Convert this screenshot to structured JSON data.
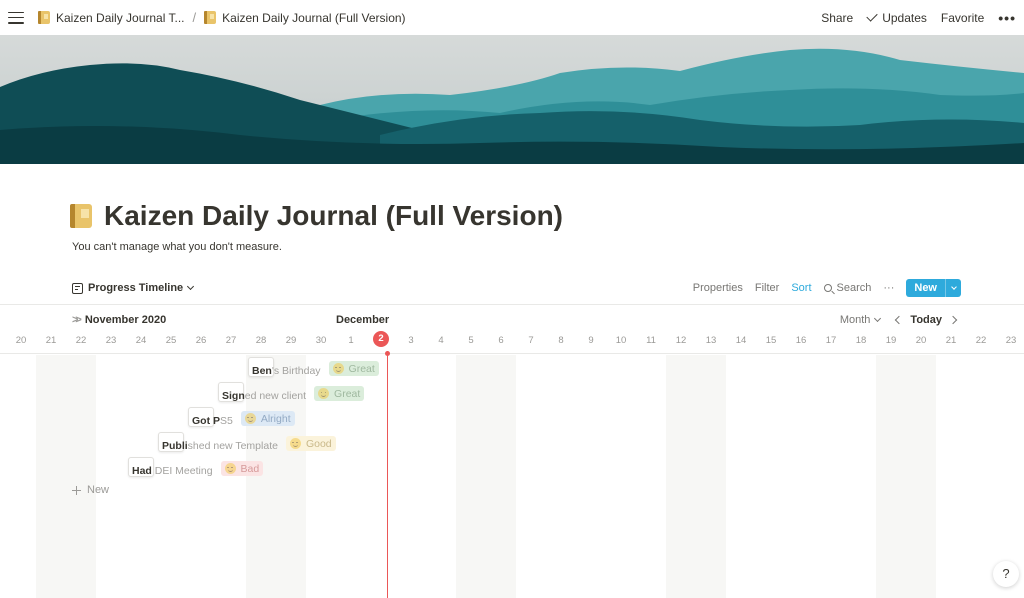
{
  "topbar": {
    "breadcrumb": [
      {
        "label": "Kaizen Daily Journal T..."
      },
      {
        "label": "Kaizen Daily Journal (Full Version)"
      }
    ],
    "separator": "/",
    "share": "Share",
    "updates": "Updates",
    "favorite": "Favorite",
    "more": "•••"
  },
  "page": {
    "title": "Kaizen Daily Journal (Full Version)",
    "subtitle": "You can't manage what you don't measure."
  },
  "view": {
    "name": "Progress Timeline",
    "actions": {
      "properties": "Properties",
      "filter": "Filter",
      "sort": "Sort",
      "search": "Search",
      "more": "···",
      "new": "New"
    }
  },
  "timeline": {
    "month_left": "November 2020",
    "month_right": "December",
    "scale": "Month",
    "today": "Today",
    "today_day": "2",
    "days": [
      "20",
      "21",
      "22",
      "23",
      "24",
      "25",
      "26",
      "27",
      "28",
      "29",
      "30",
      "1",
      "2",
      "3",
      "4",
      "5",
      "6",
      "7",
      "8",
      "9",
      "10",
      "11",
      "12",
      "13",
      "14",
      "15",
      "16",
      "17",
      "18",
      "19",
      "20",
      "21",
      "22",
      "23"
    ],
    "items": [
      {
        "lead": "Ben",
        "rest": "'s Birthday",
        "mood": "Great",
        "mood_color": "#dbeddb",
        "text_color": "#9fb89f",
        "emoji_color": "#f2c94c"
      },
      {
        "lead": "Sign",
        "rest": "ed new client",
        "mood": "Great",
        "mood_color": "#dbeddb",
        "text_color": "#9fb89f",
        "emoji_color": "#f2c94c"
      },
      {
        "lead": "Got P",
        "rest": "S5",
        "mood": "Alright",
        "mood_color": "#dde9f5",
        "text_color": "#93aac4",
        "emoji_color": "#f2c94c"
      },
      {
        "lead": "Publi",
        "rest": "shed new Template",
        "mood": "Good",
        "mood_color": "#fbf3db",
        "text_color": "#c9b889",
        "emoji_color": "#f2c94c"
      },
      {
        "lead": "Had",
        "rest": " DEI Meeting",
        "mood": "Bad",
        "mood_color": "#fbe4e4",
        "text_color": "#d69a9a",
        "emoji_color": "#f2c94c"
      }
    ],
    "add_new": "New"
  },
  "help": "?"
}
